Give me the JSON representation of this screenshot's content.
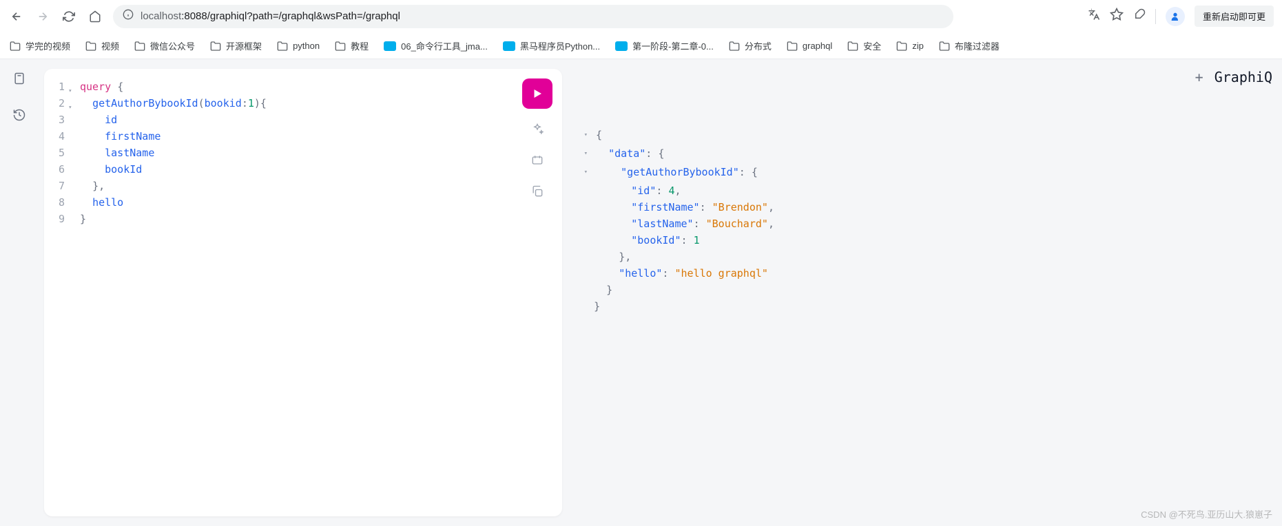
{
  "browser": {
    "url_host": "localhost",
    "url_path": ":8088/graphiql?path=/graphql&wsPath=/graphql",
    "update_label": "重新启动即可更"
  },
  "bookmarks": [
    {
      "type": "folder",
      "label": "学完的视频"
    },
    {
      "type": "folder",
      "label": "视频"
    },
    {
      "type": "folder",
      "label": "微信公众号"
    },
    {
      "type": "folder",
      "label": "开源框架"
    },
    {
      "type": "folder",
      "label": "python"
    },
    {
      "type": "folder",
      "label": "教程"
    },
    {
      "type": "bili",
      "label": "06_命令行工具_jma..."
    },
    {
      "type": "bili",
      "label": "黑马程序员Python..."
    },
    {
      "type": "bili",
      "label": "第一阶段-第二章-0..."
    },
    {
      "type": "folder",
      "label": "分布式"
    },
    {
      "type": "folder",
      "label": "graphql"
    },
    {
      "type": "folder",
      "label": "安全"
    },
    {
      "type": "folder",
      "label": "zip"
    },
    {
      "type": "folder",
      "label": "布隆过滤器"
    }
  ],
  "editor": {
    "lines": [
      "1",
      "2",
      "3",
      "4",
      "5",
      "6",
      "7",
      "8",
      "9"
    ],
    "query_keyword": "query",
    "func_name": "getAuthorBybookId",
    "arg_name": "bookid",
    "arg_value": "1",
    "fields": [
      "id",
      "firstName",
      "lastName",
      "bookId"
    ],
    "hello_field": "hello"
  },
  "response": {
    "data_key": "\"data\"",
    "getauthor_key": "\"getAuthorBybookId\"",
    "id_key": "\"id\"",
    "id_val": "4",
    "firstname_key": "\"firstName\"",
    "firstname_val": "\"Brendon\"",
    "lastname_key": "\"lastName\"",
    "lastname_val": "\"Bouchard\"",
    "bookid_key": "\"bookId\"",
    "bookid_val": "1",
    "hello_key": "\"hello\"",
    "hello_val": "\"hello graphql\""
  },
  "right": {
    "logo": "GraphiQ"
  },
  "watermark": "CSDN @不死鸟.亚历山大.狼崽子"
}
